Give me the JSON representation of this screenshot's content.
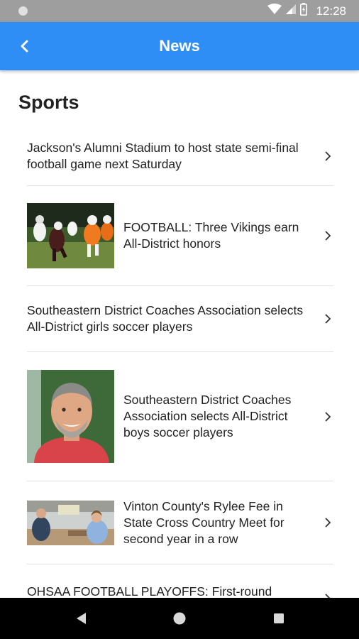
{
  "status_bar": {
    "time": "12:28",
    "icons": [
      "notification-dot-icon",
      "wifi-icon",
      "cell-signal-icon",
      "battery-icon"
    ]
  },
  "app_bar": {
    "title": "News",
    "back_icon": "back-chevron-icon",
    "color": "#2f8ef5"
  },
  "section": {
    "title": "Sports"
  },
  "articles": [
    {
      "title": "Jackson's Alumni Stadium to host state semi-final football game next Saturday",
      "has_thumbnail": false
    },
    {
      "title": "FOOTBALL: Three Vikings earn All-District honors",
      "has_thumbnail": true,
      "thumbnail": "football-action-photo"
    },
    {
      "title": "Southeastern District Coaches Association selects All-District girls soccer players",
      "has_thumbnail": false
    },
    {
      "title": "Southeastern District Coaches Association selects All-District boys soccer players",
      "has_thumbnail": true,
      "thumbnail": "coach-portrait-photo"
    },
    {
      "title": "Vinton County's Rylee Fee in State Cross Country Meet for second year in a row",
      "has_thumbnail": true,
      "thumbnail": "classroom-photo"
    },
    {
      "title": "OHSAA FOOTBALL PLAYOFFS: First-round",
      "has_thumbnail": false
    }
  ],
  "nav_bar": {
    "buttons": [
      "back-triangle-icon",
      "home-circle-icon",
      "recents-square-icon"
    ]
  }
}
